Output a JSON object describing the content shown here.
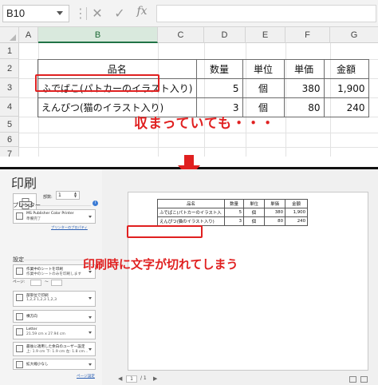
{
  "excel": {
    "name_box": "B10",
    "formula_buttons": {
      "more": "⋮",
      "cancel": "✕",
      "enter": "✓",
      "fx": "fx"
    },
    "columns": [
      "A",
      "B",
      "C",
      "D",
      "E",
      "F",
      "G"
    ],
    "selected_column": "B",
    "rows": [
      "1",
      "2",
      "3",
      "4",
      "5",
      "6",
      "7"
    ],
    "table": {
      "headers": [
        "品名",
        "数量",
        "単位",
        "単価",
        "金額"
      ],
      "rows": [
        [
          "ふでばこ(パトカーのイラスト入り)",
          "5",
          "個",
          "380",
          "1,900"
        ],
        [
          "えんぴつ(猫のイラスト入り)",
          "3",
          "個",
          "80",
          "240"
        ]
      ]
    },
    "annotation": "収まっていても・・・"
  },
  "print": {
    "title": "印刷",
    "print_button_label": "印刷",
    "copies_label": "部数:",
    "copies_value": "1",
    "printer_section": "プリンター",
    "printer_name": "MS Publisher Color Printer",
    "printer_status": "準備完了",
    "printer_properties_link": "プリンターのプロパティ",
    "settings_section": "設定",
    "settings": [
      {
        "line1": "作業中のシートを印刷",
        "line2": "作業中のシートのみを印刷します"
      },
      {
        "line1": "部単位で印刷",
        "line2": "1,2,3    1,2,3    1,2,3"
      },
      {
        "line1": "横方向",
        "line2": ""
      },
      {
        "line1": "Letter",
        "line2": "21.59 cm x 27.94 cm"
      },
      {
        "line1": "最後に適用した余白のユーザー設定",
        "line2": "上: 1.9 cm 下: 1.9 cm 左: 1.8 cm..."
      },
      {
        "line1": "拡大縮小なし",
        "line2": ""
      }
    ],
    "pages_label": "ページ:",
    "pages_to": "～",
    "page_setup_link": "ページ設定",
    "preview_table": {
      "headers": [
        "品名",
        "数量",
        "単位",
        "単価",
        "金額"
      ],
      "rows": [
        [
          "ふでばこ(パトカーのイラスト入",
          "5",
          "個",
          "380",
          "1,900"
        ],
        [
          "えんぴつ(猫のイラスト入り)",
          "3",
          "個",
          "80",
          "240"
        ]
      ]
    },
    "annotation": "印刷時に文字が切れてしまう",
    "page_current": "1",
    "page_total": "/ 1",
    "nav_prev": "◀",
    "nav_next": "▶"
  },
  "colors": {
    "accent_red": "#e02020",
    "excel_green": "#217346"
  }
}
